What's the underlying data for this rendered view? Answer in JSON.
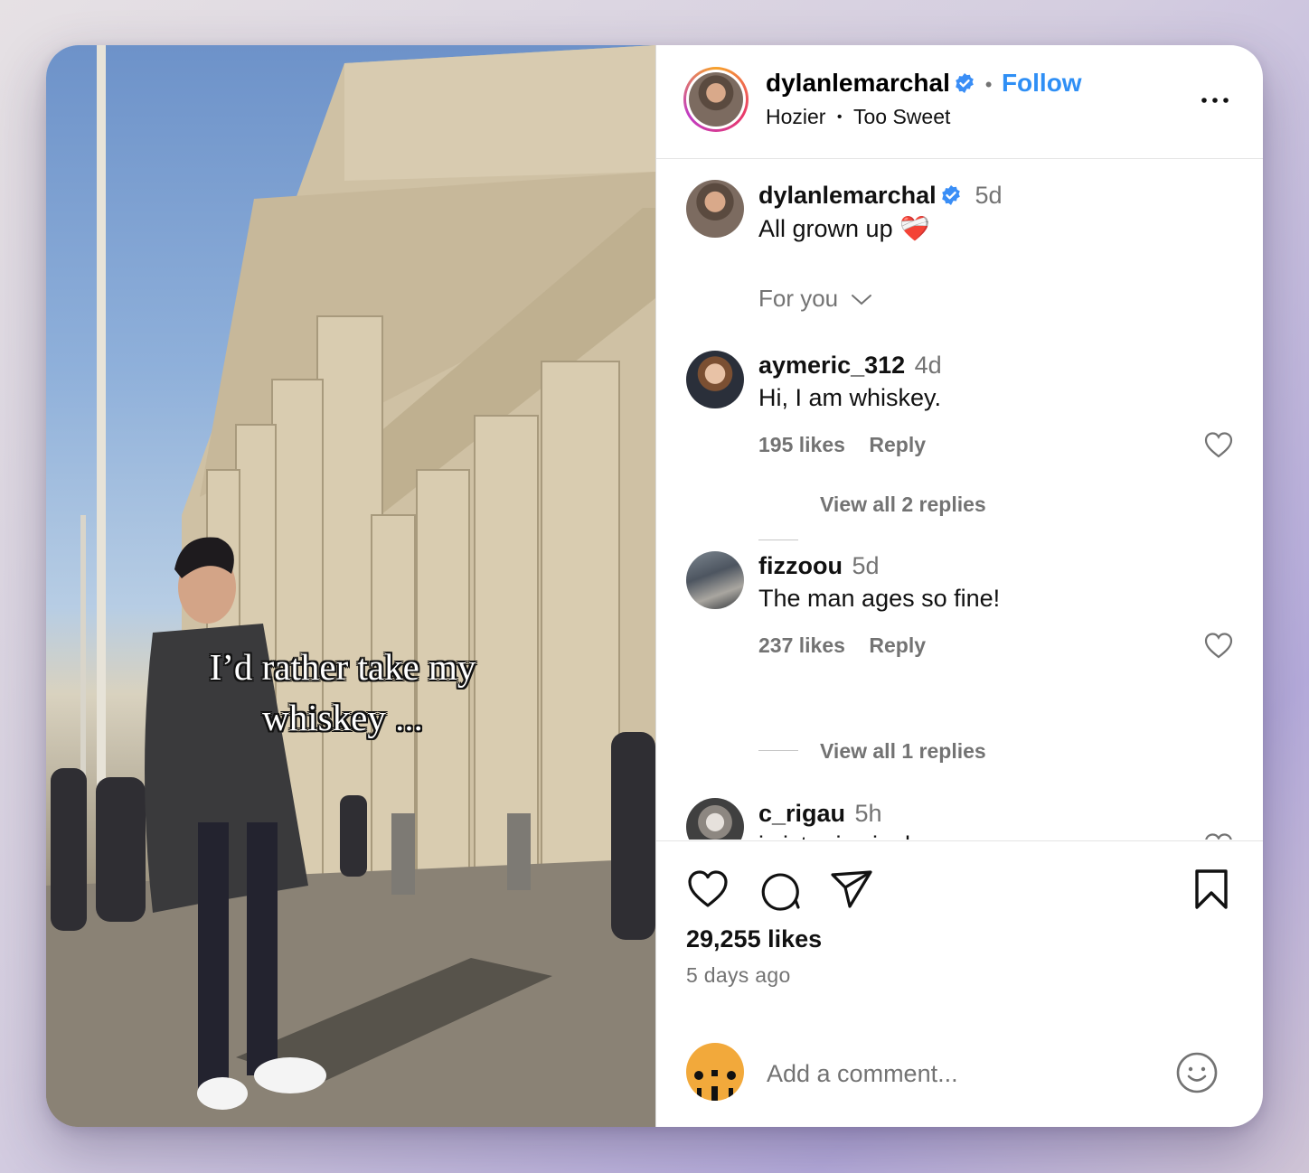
{
  "post": {
    "username": "dylanlemarchal",
    "follow_label": "Follow",
    "dot": "•",
    "music_artist": "Hozier",
    "music_sep": "•",
    "music_title": "Too Sweet",
    "media_caption": "I’d rather take my whiskey ...",
    "more_icon": "more-horizontal-icon"
  },
  "caption": {
    "username": "dylanlemarchal",
    "time": "5d",
    "text": "All grown up ❤️‍🩹"
  },
  "filter": {
    "label": "For you"
  },
  "comments": [
    {
      "username": "aymeric_312",
      "time": "4d",
      "text": "Hi, I am whiskey.",
      "likes": "195 likes",
      "reply": "Reply",
      "view_replies": "View all 2 replies"
    },
    {
      "username": "fizzoou",
      "time": "5d",
      "text": "The man ages so fine!",
      "likes": "237 likes",
      "reply": "Reply",
      "view_replies": "View all 1 replies"
    },
    {
      "username": "c_rigau",
      "time": "5h",
      "text": "i sister is single"
    }
  ],
  "footer": {
    "likes": "29,255 likes",
    "time_ago": "5 days ago",
    "add_comment_placeholder": "Add a comment..."
  },
  "colors": {
    "accent": "#2f8ff5",
    "muted": "#737373"
  }
}
